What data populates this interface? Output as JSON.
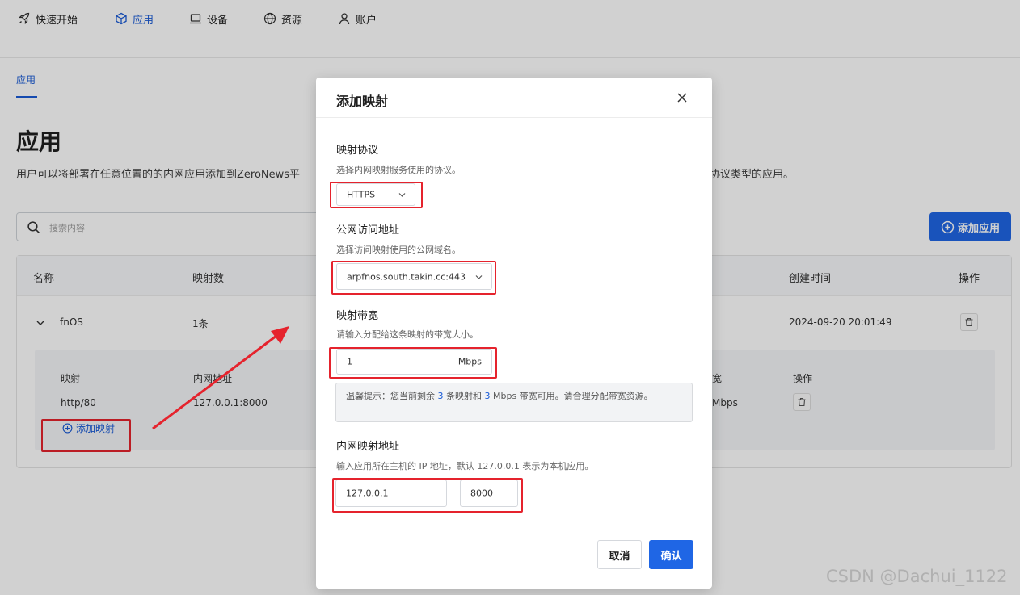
{
  "nav": {
    "items": [
      {
        "label": "快速开始",
        "icon": "rocket-icon"
      },
      {
        "label": "应用",
        "icon": "cube-icon"
      },
      {
        "label": "设备",
        "icon": "laptop-icon"
      },
      {
        "label": "资源",
        "icon": "globe-icon"
      },
      {
        "label": "账户",
        "icon": "user-icon"
      }
    ],
    "active": "应用"
  },
  "subtab": {
    "label": "应用"
  },
  "page": {
    "title": "应用",
    "description": "用户可以将部署在任意位置的的内网应用添加到ZeroNews平",
    "description_tail": "协议类型的应用。"
  },
  "search": {
    "placeholder": "搜索内容"
  },
  "add_app_button": {
    "label": "添加应用"
  },
  "table": {
    "headers": {
      "name": "名称",
      "mappings": "映射数",
      "created": "创建时间",
      "actions": "操作"
    },
    "row": {
      "name": "fnOS",
      "mappings": "1条",
      "created": "2024-09-20 20:01:49"
    },
    "sub_headers": {
      "mapping": "映射",
      "internal": "内网地址",
      "bandwidth": "宽",
      "actions": "操作"
    },
    "sub_row": {
      "mapping": "http/80",
      "internal": "127.0.0.1:8000",
      "bandwidth": "Mbps"
    },
    "add_mapping_link": "添加映射"
  },
  "modal": {
    "title": "添加映射",
    "protocol": {
      "label": "映射协议",
      "desc": "选择内网映射服务使用的协议。",
      "value": "HTTPS"
    },
    "domain": {
      "label": "公网访问地址",
      "desc": "选择访问映射使用的公网域名。",
      "value": "arpfnos.south.takin.cc:443"
    },
    "bandwidth": {
      "label": "映射带宽",
      "desc": "请输入分配给这条映射的带宽大小。",
      "value": "1",
      "unit": "Mbps"
    },
    "tip": {
      "prefix": "温馨提示：您当前剩余",
      "remaining_mappings": "3",
      "mid": "条映射和",
      "remaining_bandwidth": "3",
      "suffix": "Mbps 带宽可用。请合理分配带宽资源。"
    },
    "internal": {
      "label": "内网映射地址",
      "desc": "输入应用所在主机的 IP 地址，默认 127.0.0.1 表示为本机应用。",
      "ip": "127.0.0.1",
      "port": "8000"
    },
    "cancel_label": "取消",
    "confirm_label": "确认"
  },
  "watermark": "CSDN @Dachui_1122",
  "colors": {
    "accent": "#1f66e5",
    "annotation_red": "#e5232d",
    "overlay": "rgba(0,0,0,0.18)"
  }
}
